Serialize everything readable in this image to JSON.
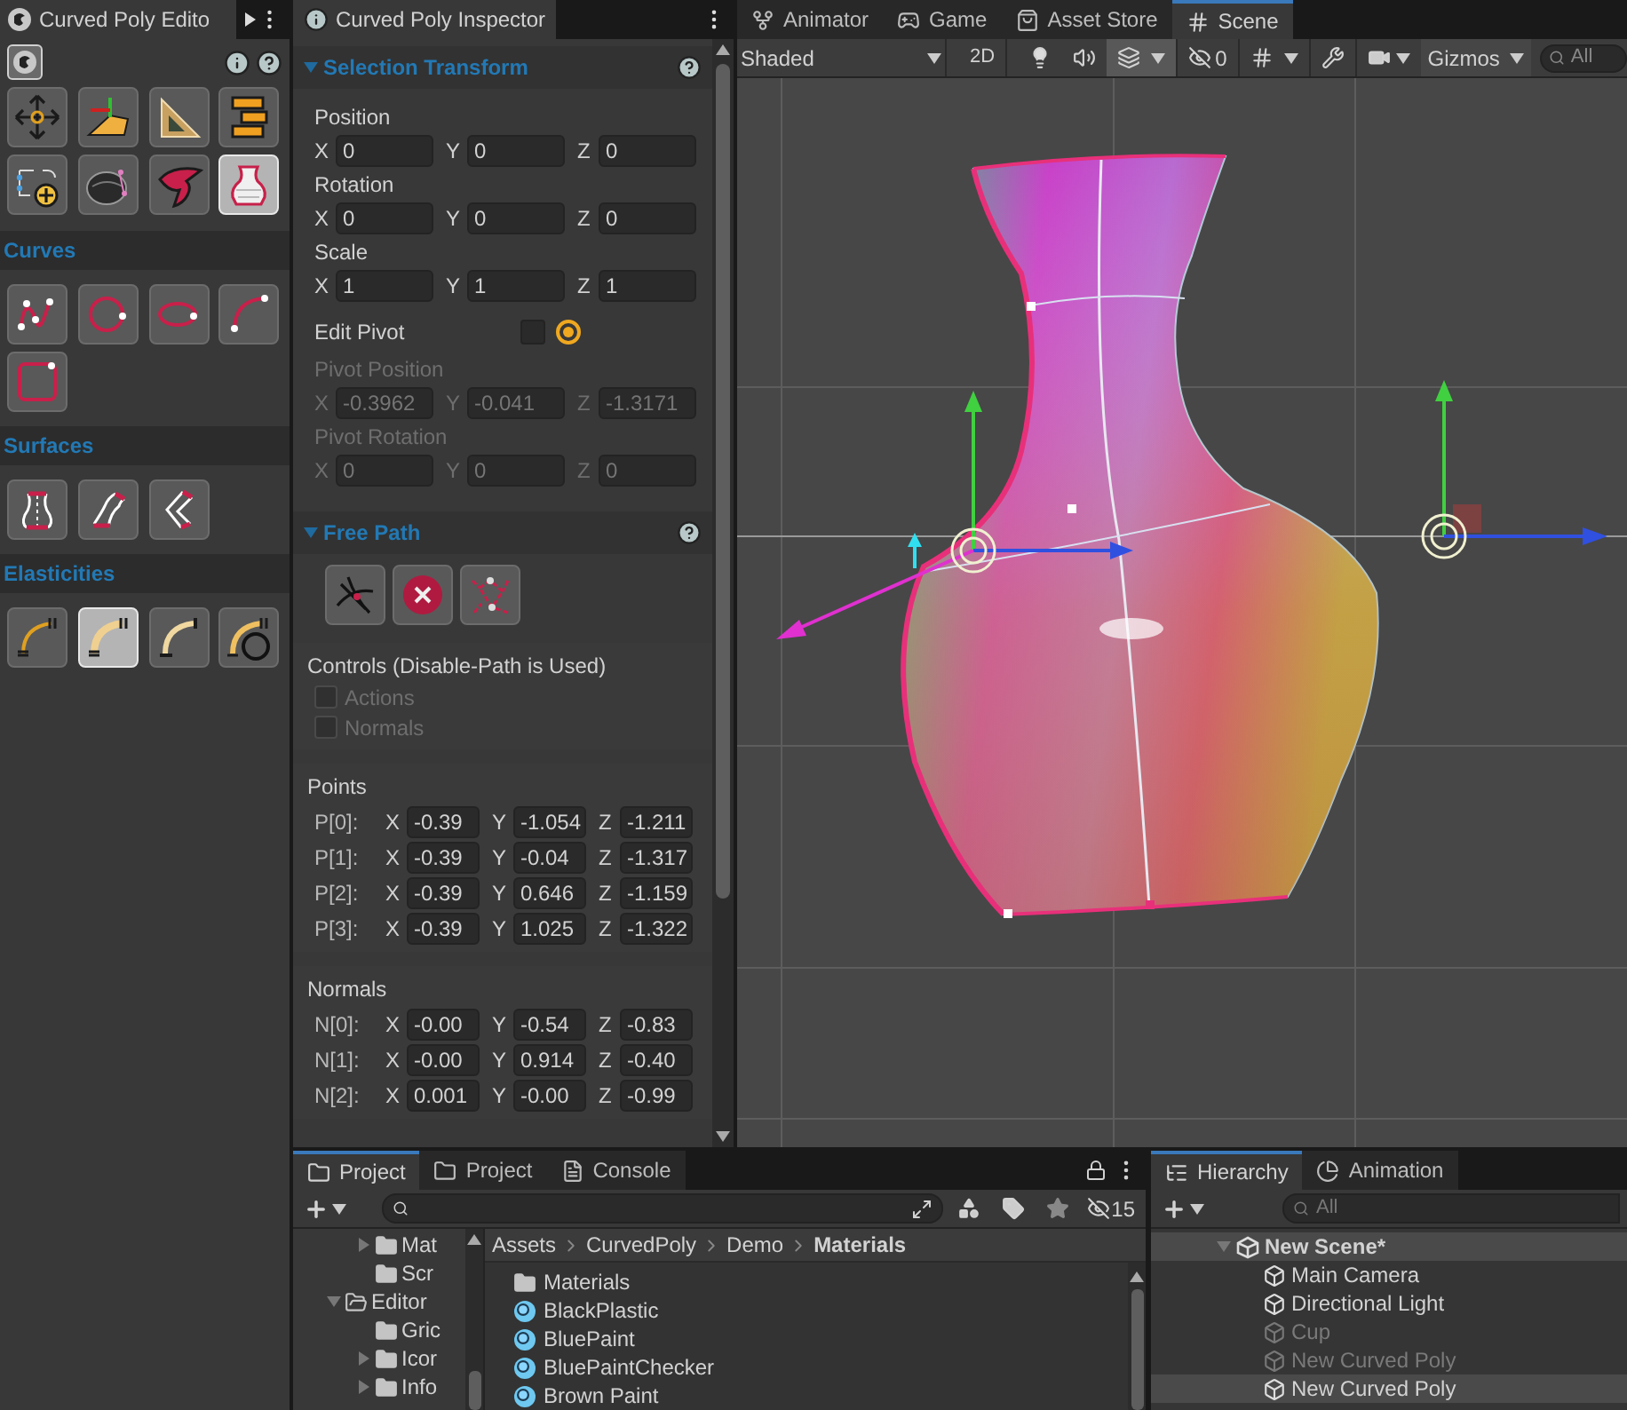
{
  "tool_panel": {
    "tab": "Curved Poly Edito",
    "main_tools": [
      {
        "kind": "move",
        "selected": false
      },
      {
        "kind": "pivot",
        "selected": false
      },
      {
        "kind": "ruler",
        "selected": false
      },
      {
        "kind": "align",
        "selected": false
      },
      {
        "kind": "add-points",
        "selected": false
      },
      {
        "kind": "helmet",
        "selected": false
      },
      {
        "kind": "ribbon",
        "selected": false
      },
      {
        "kind": "vase",
        "selected": true
      }
    ],
    "sections": [
      {
        "title": "Curves",
        "tools": [
          {
            "kind": "polyline",
            "selected": false
          },
          {
            "kind": "circle",
            "selected": false
          },
          {
            "kind": "ellipse",
            "selected": false
          },
          {
            "kind": "arc",
            "selected": false
          },
          {
            "kind": "square",
            "selected": false
          }
        ]
      },
      {
        "title": "Surfaces",
        "tools": [
          {
            "kind": "lathe",
            "selected": false
          },
          {
            "kind": "bend",
            "selected": false
          },
          {
            "kind": "sweep",
            "selected": false
          }
        ]
      },
      {
        "title": "Elasticities",
        "tools": [
          {
            "kind": "spring",
            "selected": false
          },
          {
            "kind": "thick-spring",
            "selected": true
          },
          {
            "kind": "bar",
            "selected": false
          },
          {
            "kind": "loop-spring",
            "selected": false
          }
        ]
      }
    ]
  },
  "inspector": {
    "tab": "Curved Poly Inspector",
    "transform": {
      "title": "Selection Transform",
      "expanded": true,
      "vectors": [
        {
          "label": "Position",
          "disabled": false,
          "values": [
            {
              "axis": "X",
              "value": "0"
            },
            {
              "axis": "Y",
              "value": "0"
            },
            {
              "axis": "Z",
              "value": "0"
            }
          ]
        },
        {
          "label": "Rotation",
          "disabled": false,
          "values": [
            {
              "axis": "X",
              "value": "0"
            },
            {
              "axis": "Y",
              "value": "0"
            },
            {
              "axis": "Z",
              "value": "0"
            }
          ]
        },
        {
          "label": "Scale",
          "disabled": false,
          "values": [
            {
              "axis": "X",
              "value": "1"
            },
            {
              "axis": "Y",
              "value": "1"
            },
            {
              "axis": "Z",
              "value": "1"
            }
          ]
        }
      ],
      "edit_pivot": {
        "label": "Edit Pivot",
        "checked": false,
        "pivot_on": true
      },
      "pivot_vectors": [
        {
          "label": "Pivot Position",
          "disabled": true,
          "values": [
            {
              "axis": "X",
              "value": "-0.3962"
            },
            {
              "axis": "Y",
              "value": "-0.041"
            },
            {
              "axis": "Z",
              "value": "-1.3171"
            }
          ]
        },
        {
          "label": "Pivot Rotation",
          "disabled": true,
          "values": [
            {
              "axis": "X",
              "value": "0"
            },
            {
              "axis": "Y",
              "value": "0"
            },
            {
              "axis": "Z",
              "value": "0"
            }
          ]
        }
      ]
    },
    "free_path": {
      "title": "Free Path",
      "expanded": true,
      "buttons": [
        {
          "kind": "cross"
        },
        {
          "kind": "delete"
        },
        {
          "kind": "nodes"
        }
      ],
      "controls": {
        "title": "Controls (Disable-Path is Used)",
        "options": [
          {
            "label": "Actions",
            "checked": false,
            "disabled": true
          },
          {
            "label": "Normals",
            "checked": false,
            "disabled": true
          }
        ]
      },
      "points": {
        "title": "Points",
        "rows": [
          {
            "label": "P[0]:",
            "values": [
              {
                "axis": "X",
                "value": "-0.39"
              },
              {
                "axis": "Y",
                "value": "-1.054"
              },
              {
                "axis": "Z",
                "value": "-1.211"
              }
            ]
          },
          {
            "label": "P[1]:",
            "values": [
              {
                "axis": "X",
                "value": "-0.39"
              },
              {
                "axis": "Y",
                "value": "-0.04"
              },
              {
                "axis": "Z",
                "value": "-1.317"
              }
            ]
          },
          {
            "label": "P[2]:",
            "values": [
              {
                "axis": "X",
                "value": "-0.39"
              },
              {
                "axis": "Y",
                "value": "0.646"
              },
              {
                "axis": "Z",
                "value": "-1.159"
              }
            ]
          },
          {
            "label": "P[3]:",
            "values": [
              {
                "axis": "X",
                "value": "-0.39"
              },
              {
                "axis": "Y",
                "value": "1.025"
              },
              {
                "axis": "Z",
                "value": "-1.322"
              }
            ]
          }
        ]
      },
      "normals": {
        "title": "Normals",
        "rows": [
          {
            "label": "N[0]:",
            "values": [
              {
                "axis": "X",
                "value": "-0.00"
              },
              {
                "axis": "Y",
                "value": "-0.54"
              },
              {
                "axis": "Z",
                "value": "-0.83"
              }
            ]
          },
          {
            "label": "N[1]:",
            "values": [
              {
                "axis": "X",
                "value": "-0.00"
              },
              {
                "axis": "Y",
                "value": "0.914"
              },
              {
                "axis": "Z",
                "value": "-0.40"
              }
            ]
          },
          {
            "label": "N[2]:",
            "values": [
              {
                "axis": "X",
                "value": "0.001"
              },
              {
                "axis": "Y",
                "value": "-0.00"
              },
              {
                "axis": "Z",
                "value": "-0.99"
              }
            ]
          }
        ]
      }
    }
  },
  "scene": {
    "tabs": [
      {
        "label": "Animator",
        "selected": false
      },
      {
        "label": "Game",
        "selected": false
      },
      {
        "label": "Asset Store",
        "selected": false
      },
      {
        "label": "Scene",
        "selected": true
      }
    ],
    "toolbar": {
      "shading": "Shaded",
      "two_d": {
        "label": "2D",
        "on": false
      },
      "lighting_on": false,
      "audio_on": false,
      "effects_on": true,
      "hidden_count": "0",
      "grid_on": false,
      "gizmos": "Gizmos",
      "search_placeholder": "All"
    }
  },
  "project": {
    "tabs": [
      {
        "label": "Project",
        "selected": true
      },
      {
        "label": "Project",
        "selected": false
      },
      {
        "label": "Console",
        "selected": false
      }
    ],
    "hidden_count": "15",
    "tree": [
      {
        "children": [
          {
            "label": "Mat",
            "expanded": false
          },
          {
            "label": "Scr"
          }
        ]
      },
      {
        "label": "Editor",
        "expanded": true,
        "children": [
          {
            "label": "Gric"
          },
          {
            "label": "Icor",
            "expanded": false
          },
          {
            "label": "Info",
            "expanded": false
          }
        ]
      }
    ],
    "breadcrumb": [
      "Assets",
      "CurvedPoly",
      "Demo",
      "Materials"
    ],
    "files": [
      {
        "kind": "folder",
        "label": "Materials"
      },
      {
        "kind": "material",
        "label": "BlackPlastic"
      },
      {
        "kind": "material",
        "label": "BluePaint"
      },
      {
        "kind": "material",
        "label": "BluePaintChecker"
      },
      {
        "kind": "material",
        "label": "Brown Paint"
      }
    ]
  },
  "hierarchy": {
    "tabs": [
      {
        "label": "Hierarchy",
        "selected": true
      },
      {
        "label": "Animation",
        "selected": false
      }
    ],
    "search_placeholder": "All",
    "scene": {
      "label": "New Scene*",
      "expanded": true,
      "children": [
        {
          "label": "Main Camera",
          "active": true,
          "selected": false
        },
        {
          "label": "Directional Light",
          "active": true,
          "selected": false
        },
        {
          "label": "Cup",
          "active": false,
          "selected": false
        },
        {
          "label": "New Curved Poly",
          "active": false,
          "selected": false
        },
        {
          "label": "New Curved Poly",
          "active": true,
          "selected": true
        }
      ]
    }
  }
}
